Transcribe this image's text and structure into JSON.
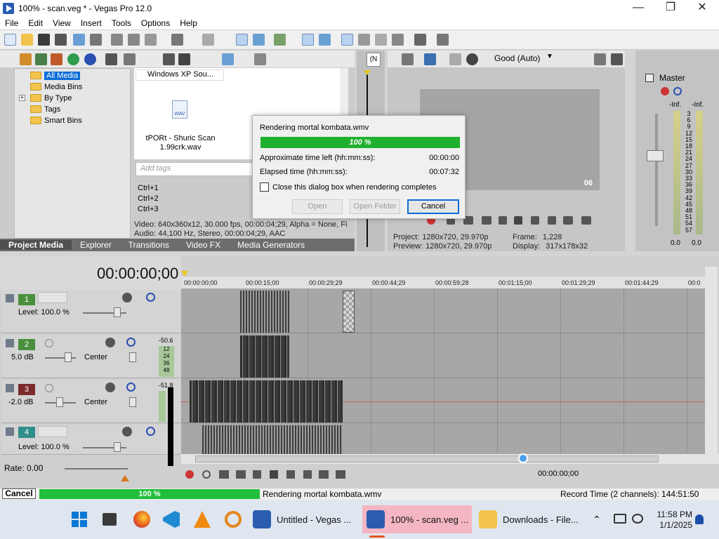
{
  "window": {
    "title": "100% - scan.veg * - Vegas Pro 12.0",
    "minimize_glyph": "—",
    "maximize_glyph": "❐",
    "close_glyph": "✕"
  },
  "menu": [
    "File",
    "Edit",
    "View",
    "Insert",
    "Tools",
    "Options",
    "Help"
  ],
  "project_media": {
    "tree": [
      "All Media",
      "Media Bins",
      "By Type",
      "Tags",
      "Smart Bins"
    ],
    "files": [
      {
        "name": "Windows XP Sou..."
      },
      {
        "name": "tPORt - Shuric Scan 1.99crk.wav",
        "icon_label": "WAV"
      }
    ],
    "tags_placeholder": "Add tags",
    "shortcuts": [
      "Ctrl+1",
      "Ctrl+2",
      "Ctrl+3"
    ],
    "video_info": "Video: 640x360x12, 30.000 fps, 00:00:04;29, Alpha = None, Fi",
    "audio_info": "Audio: 44,100 Hz, Stereo, 00:00:04;29, AAC",
    "tabs": [
      "Project Media",
      "Explorer",
      "Transitions",
      "Video FX",
      "Media Generators"
    ]
  },
  "trimmer": {
    "label": "(N"
  },
  "preview": {
    "quality": "Good (Auto)",
    "overlay_number": "06",
    "project_label": "Project:",
    "project_value": "1280x720, 29.970p",
    "preview_label": "Preview:",
    "preview_value": "1280x720, 29.970p",
    "frame_label": "Frame:",
    "frame_value": "1,228",
    "display_label": "Display:",
    "display_value": "317x178x32"
  },
  "master": {
    "title": "Master",
    "inf_left": "-Inf.",
    "inf_right": "-Inf.",
    "scale": [
      "3",
      "6",
      "9",
      "12",
      "15",
      "18",
      "21",
      "24",
      "27",
      "30",
      "33",
      "36",
      "39",
      "42",
      "45",
      "48",
      "51",
      "54",
      "57"
    ],
    "bottom_left": "0.0",
    "bottom_right": "0.0"
  },
  "timeline": {
    "timecode": "00:00:00;00",
    "ruler": [
      "00:00:00;00",
      "00:00:15;00",
      "00:00:29;29",
      "00:00:44;29",
      "00:00:59;28",
      "00:01:15;00",
      "00:01:29;29",
      "00:01:44;29",
      "00:0"
    ],
    "tracks": [
      {
        "num": "1",
        "type": "video",
        "label": "Level: 100.0 %"
      },
      {
        "num": "2",
        "type": "audio",
        "label": "5.0 dB",
        "pan": "Center",
        "meter_top": "-50.6",
        "meter_ticks": [
          "12",
          "24",
          "36",
          "48"
        ]
      },
      {
        "num": "3",
        "type": "audio",
        "label": "-2.0 dB",
        "pan": "Center",
        "meter_top": "-51.8"
      },
      {
        "num": "4",
        "type": "video",
        "label": "Level: 100.0 %"
      }
    ],
    "rate": "Rate: 0.00",
    "transport_time": "00:00:00;00"
  },
  "status": {
    "cancel": "Cancel",
    "progress_text": "100 %",
    "progress": 1.0,
    "message": "Rendering mortal kombata.wmv",
    "record_time": "Record Time (2 channels): 144:51:50"
  },
  "dialog": {
    "title": "Rendering mortal kombata.wmv",
    "progress_text": "100 %",
    "progress": 1.0,
    "time_left_label": "Approximate time left (hh:mm:ss):",
    "time_left_value": "00:00:00",
    "elapsed_label": "Elapsed time (hh:mm:ss):",
    "elapsed_value": "00:07:32",
    "checkbox_label": "Close this dialog box when rendering completes",
    "checkbox_checked": false,
    "open_label": "Open",
    "open_folder_label": "Open Folder",
    "cancel_label": "Cancel"
  },
  "taskbar": {
    "apps": [
      {
        "label": "Untitled - Vegas ...",
        "icon": "vegas-icon"
      },
      {
        "label": "100% - scan.veg ...",
        "icon": "vegas-icon",
        "active": true
      },
      {
        "label": "Downloads - File...",
        "icon": "folder-icon"
      }
    ],
    "time": "11:58 PM",
    "date": "1/1/2025"
  },
  "colors": {
    "progress_green": "#1fbf3a",
    "dialog_green": "#1fb02e",
    "track_video": "#4b8f3d",
    "track_audio": "#7c2a2a",
    "selection_blue": "#0a6cd6"
  }
}
